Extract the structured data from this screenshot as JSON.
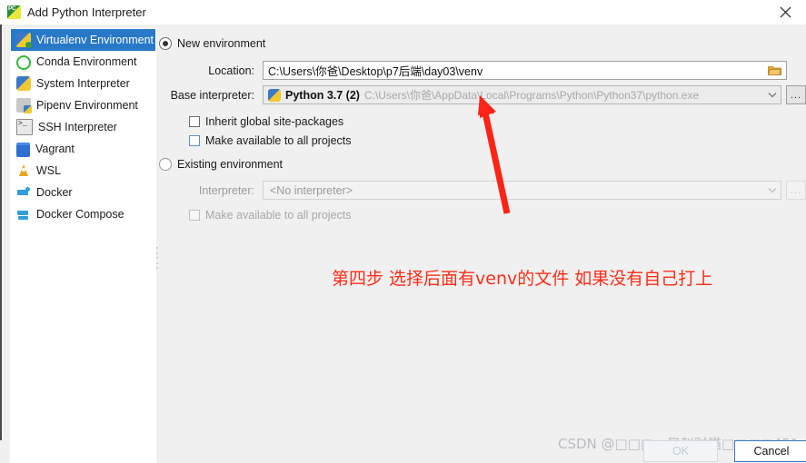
{
  "window": {
    "title": "Add Python Interpreter",
    "app_icon": "pycharm-icon",
    "close_icon": "close-icon"
  },
  "sidebar": {
    "items": [
      {
        "label": "Virtualenv Environment",
        "icon": "virtualenv-icon",
        "selected": true
      },
      {
        "label": "Conda Environment",
        "icon": "conda-icon",
        "selected": false
      },
      {
        "label": "System Interpreter",
        "icon": "python-icon",
        "selected": false
      },
      {
        "label": "Pipenv Environment",
        "icon": "pipenv-icon",
        "selected": false
      },
      {
        "label": "SSH Interpreter",
        "icon": "terminal-icon",
        "selected": false
      },
      {
        "label": "Vagrant",
        "icon": "vagrant-icon",
        "selected": false
      },
      {
        "label": "WSL",
        "icon": "wsl-icon",
        "selected": false
      },
      {
        "label": "Docker",
        "icon": "docker-icon",
        "selected": false
      },
      {
        "label": "Docker Compose",
        "icon": "docker-compose-icon",
        "selected": false
      }
    ]
  },
  "new_environment": {
    "radio_label": "New environment",
    "radio_selected": true,
    "location_label": "Location:",
    "location_value": "C:\\Users\\你爸\\Desktop\\p7后端\\day03\\venv",
    "location_browse_icon": "folder-icon",
    "base_interpreter_label": "Base interpreter:",
    "base_interpreter_name": "Python 3.7 (2)",
    "base_interpreter_path": "C:\\Users\\你爸\\AppData\\Local\\Programs\\Python\\Python37\\python.exe",
    "base_interpreter_icon": "python-icon",
    "base_interpreter_dropdown_icon": "chevron-down-icon",
    "base_interpreter_more_label": "...",
    "inherit_label": "Inherit global site-packages",
    "inherit_checked": false,
    "make_available_label": "Make available to all projects",
    "make_available_checked": false
  },
  "existing_environment": {
    "radio_label": "Existing environment",
    "radio_selected": false,
    "interpreter_label": "Interpreter:",
    "interpreter_value": "<No interpreter>",
    "interpreter_dropdown_icon": "chevron-down-icon",
    "interpreter_more_label": "...",
    "make_available_label": "Make available to all projects",
    "make_available_checked": false
  },
  "annotation": {
    "text": "第四步 选择后面有venv的文件  如果没有自己打上",
    "color": "#ff2d18",
    "arrow_color": "#ff2416"
  },
  "watermark": {
    "text": "CSDN @□□□一只赵财猫□□□□451"
  },
  "footer": {
    "ok_label": "OK",
    "cancel_label": "Cancel"
  }
}
